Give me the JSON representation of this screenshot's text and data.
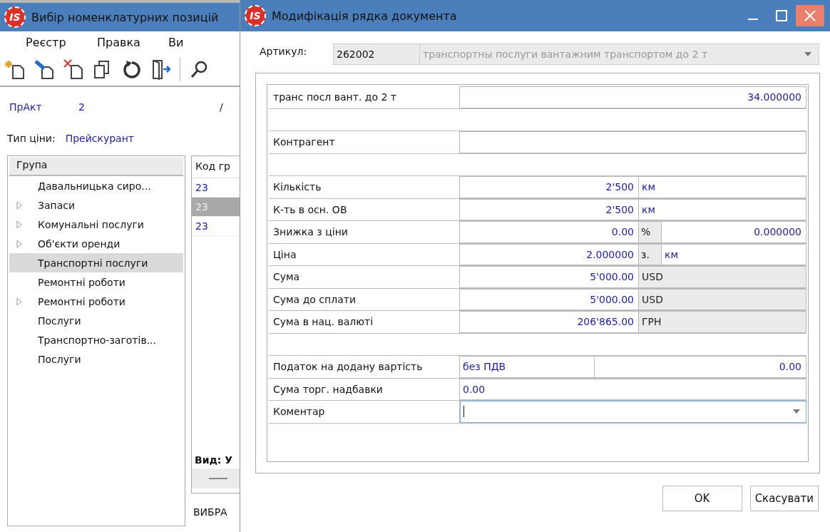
{
  "back_window": {
    "logo": "IS",
    "title": "Вибір номенклатурних позицій",
    "menu": [
      "Реєстр",
      "Правка",
      "Ви"
    ],
    "document": {
      "type": "ПрАкт",
      "number": "2",
      "separator": "/"
    },
    "price_type": {
      "label": "Тип ціни:",
      "value": "Прейскурант"
    },
    "tree": {
      "header": "Група",
      "items": [
        {
          "label": "Давальницька сиро...",
          "expandable": false,
          "selected": false
        },
        {
          "label": "Запаси",
          "expandable": true,
          "selected": false
        },
        {
          "label": "Комунальні послуги",
          "expandable": true,
          "selected": false
        },
        {
          "label": "Об'єкти оренди",
          "expandable": true,
          "selected": false
        },
        {
          "label": "Транспортні послуги",
          "expandable": false,
          "selected": true
        },
        {
          "label": "Ремонтні роботи",
          "expandable": false,
          "selected": false
        },
        {
          "label": "Ремонтні роботи",
          "expandable": true,
          "selected": false
        },
        {
          "label": "Послуги",
          "expandable": false,
          "selected": false
        },
        {
          "label": "Транспортно-заготів...",
          "expandable": false,
          "selected": false
        },
        {
          "label": "Послуги",
          "expandable": false,
          "selected": false
        }
      ]
    },
    "codes": {
      "header": "Код гр",
      "rows": [
        {
          "code": "23",
          "selected": false
        },
        {
          "code": "23",
          "selected": true
        },
        {
          "code": "23",
          "selected": false
        }
      ],
      "footer": "Вид: У"
    },
    "status": "ВИБРА"
  },
  "dialog": {
    "logo": "IS",
    "title": "Модифікація рядка документа",
    "article": {
      "label": "Артикул:",
      "code": "262002",
      "name": "транспортны послуги вантажним транспортом до 2 т"
    },
    "rows": [
      {
        "kind": "value",
        "label": "транс посл  вант. до 2 т",
        "value": "34.000000"
      },
      {
        "kind": "spacer"
      },
      {
        "kind": "empty",
        "label": "Контрагент"
      },
      {
        "kind": "spacer"
      },
      {
        "kind": "unit",
        "label": "Кількість",
        "value": "2'500",
        "unit": "км",
        "readonly": false
      },
      {
        "kind": "unit",
        "label": "К-ть в осн. ОВ",
        "value": "2'500",
        "unit": "км",
        "readonly": false
      },
      {
        "kind": "rate",
        "label": "Знижка з ціни",
        "value": "0.00",
        "tag": "%",
        "extra": "0.000000"
      },
      {
        "kind": "per",
        "label": "Ціна",
        "value": "2.000000",
        "tag": "з.",
        "extra": "км"
      },
      {
        "kind": "unit",
        "label": "Сума",
        "value": "5'000.00",
        "unit": "USD",
        "readonly": true
      },
      {
        "kind": "unit",
        "label": "Сума до сплати",
        "value": "5'000.00",
        "unit": "USD",
        "readonly": true
      },
      {
        "kind": "unit",
        "label": "Сума в нац. валюті",
        "value": "206'865.00",
        "unit": "ГРН",
        "readonly": true
      },
      {
        "kind": "spacer"
      },
      {
        "kind": "tax",
        "label": "Податок на додану вартість",
        "text": "без ПДВ",
        "value": "0.00"
      },
      {
        "kind": "text",
        "label": "Сума торг. надбавки",
        "value": "0.00"
      },
      {
        "kind": "combo",
        "label": "Коментар",
        "focused": true
      }
    ],
    "buttons": [
      "OK",
      "Скасувати"
    ]
  }
}
